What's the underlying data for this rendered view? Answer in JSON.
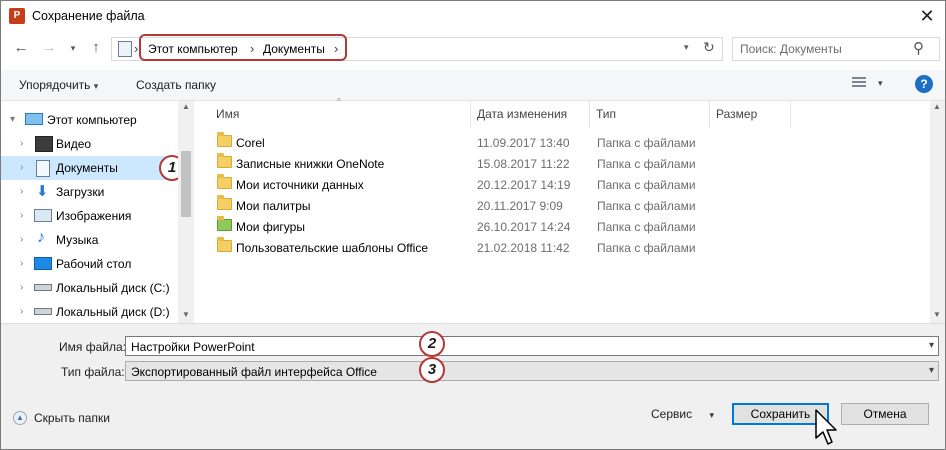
{
  "window": {
    "title": "Сохранение файла",
    "app_icon": "P"
  },
  "nav": {
    "breadcrumb": [
      "Этот компьютер",
      "Документы"
    ],
    "search_placeholder": "Поиск: Документы"
  },
  "toolbar": {
    "organize": "Упорядочить",
    "new_folder": "Создать папку",
    "help": "?"
  },
  "tree": [
    {
      "label": "Этот компьютер",
      "icon": "computer-icon"
    },
    {
      "label": "Видео",
      "icon": "video-icon"
    },
    {
      "label": "Документы",
      "icon": "documents-icon",
      "selected": true
    },
    {
      "label": "Загрузки",
      "icon": "downloads-icon"
    },
    {
      "label": "Изображения",
      "icon": "pictures-icon"
    },
    {
      "label": "Музыка",
      "icon": "music-icon"
    },
    {
      "label": "Рабочий стол",
      "icon": "desktop-icon"
    },
    {
      "label": "Локальный диск (C:)",
      "icon": "drive-icon"
    },
    {
      "label": "Локальный диск (D:)",
      "icon": "drive-icon"
    }
  ],
  "columns": {
    "name": "Имя",
    "date": "Дата изменения",
    "type": "Тип",
    "size": "Размер"
  },
  "files": [
    {
      "name": "Corel",
      "date": "11.09.2017 13:40",
      "type": "Папка с файлами"
    },
    {
      "name": "Записные книжки OneNote",
      "date": "15.08.2017 11:22",
      "type": "Папка с файлами"
    },
    {
      "name": "Мои источники данных",
      "date": "20.12.2017 14:19",
      "type": "Папка с файлами"
    },
    {
      "name": "Мои палитры",
      "date": "20.11.2017 9:09",
      "type": "Папка с файлами"
    },
    {
      "name": "Мои фигуры",
      "date": "26.10.2017 14:24",
      "type": "Папка с файлами"
    },
    {
      "name": "Пользовательские шаблоны Office",
      "date": "21.02.2018 11:42",
      "type": "Папка с файлами"
    }
  ],
  "form": {
    "filename_label": "Имя файла:",
    "filename_value": "Настройки PowerPoint",
    "filetype_label": "Тип файла:",
    "filetype_value": "Экспортированный файл интерфейса Office"
  },
  "footer": {
    "hide_folders": "Скрыть папки",
    "tools": "Сервис",
    "save": "Сохранить",
    "cancel": "Отмена"
  },
  "callouts": [
    "1",
    "2",
    "3"
  ],
  "colors": {
    "callout_border": "#b53838",
    "selection": "#cce8ff",
    "primary_border": "#0078d7"
  }
}
